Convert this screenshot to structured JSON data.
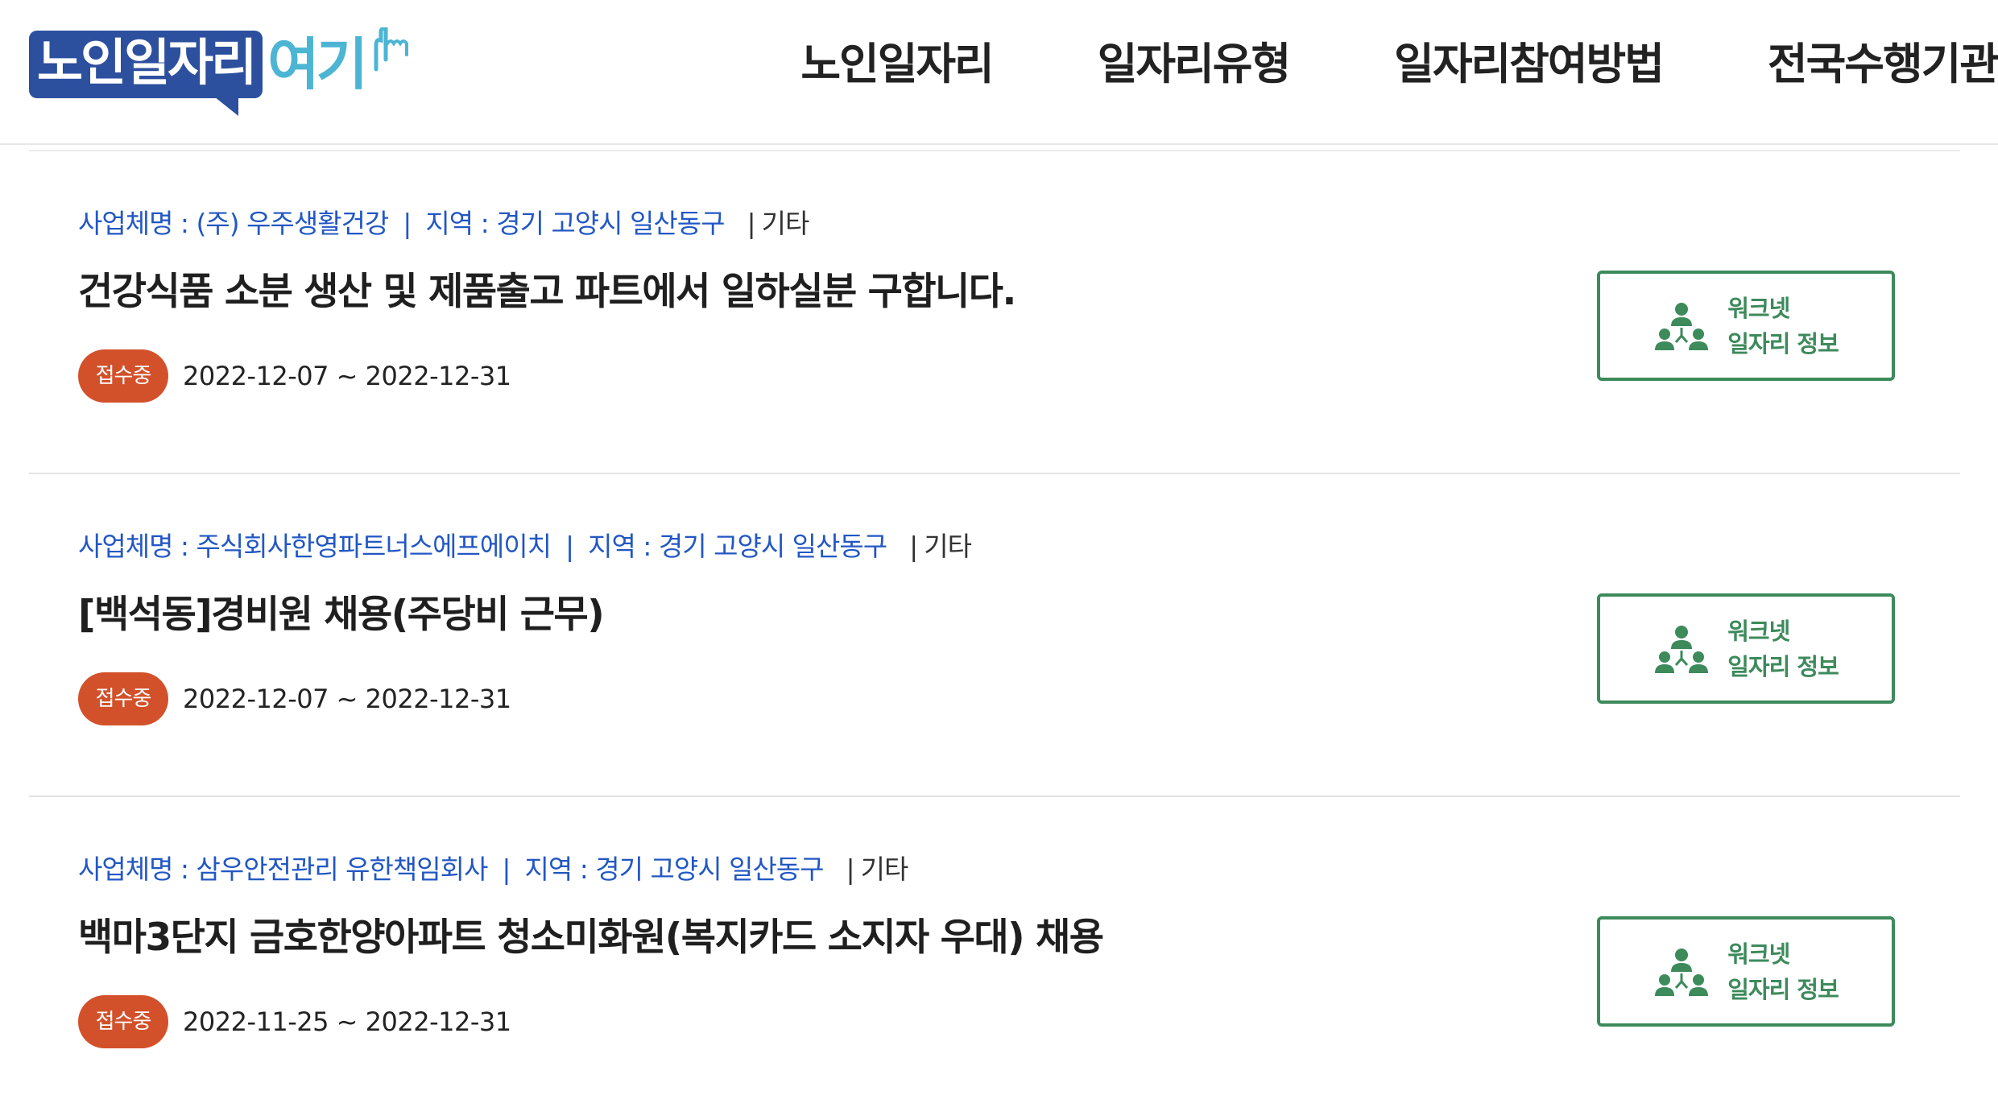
{
  "logo": {
    "part1": "노인일자리",
    "part2": "여기"
  },
  "nav": {
    "items": [
      "노인일자리",
      "일자리유형",
      "일자리참여방법",
      "전국수행기관"
    ]
  },
  "jobs": [
    {
      "business_label": "사업체명 : (주) 우주생활건강",
      "separator": "|",
      "region_label": "지역 : 경기 고양시 일산동구",
      "category_bar": "|",
      "category": "기타",
      "title": "건강식품 소분 생산 및 제품출고 파트에서 일하실분 구합니다.",
      "status": "접수중",
      "period": "2022-12-07 ~ 2022-12-31",
      "worknet_line1": "워크넷",
      "worknet_line2": "일자리 정보"
    },
    {
      "business_label": "사업체명 : 주식회사한영파트너스에프에이치",
      "separator": "|",
      "region_label": "지역 : 경기 고양시 일산동구",
      "category_bar": "|",
      "category": "기타",
      "title": "[백석동]경비원 채용(주당비 근무)",
      "status": "접수중",
      "period": "2022-12-07 ~ 2022-12-31",
      "worknet_line1": "워크넷",
      "worknet_line2": "일자리 정보"
    },
    {
      "business_label": "사업체명 : 삼우안전관리 유한책임회사",
      "separator": "|",
      "region_label": "지역 : 경기 고양시 일산동구",
      "category_bar": "|",
      "category": "기타",
      "title": "백마3단지 금호한양아파트 청소미화원(복지카드 소지자 우대) 채용",
      "status": "접수중",
      "period": "2022-11-25 ~ 2022-12-31",
      "worknet_line1": "워크넷",
      "worknet_line2": "일자리 정보"
    }
  ],
  "icons": {
    "worknet": "people-network-icon",
    "logo_mark": "pointing-hand-icon"
  },
  "colors": {
    "link_blue": "#2257c4",
    "badge_orange": "#d2512a",
    "worknet_green": "#3d8a5b",
    "logo_navy": "#2c4f9e",
    "logo_sky": "#4cb5d3"
  }
}
